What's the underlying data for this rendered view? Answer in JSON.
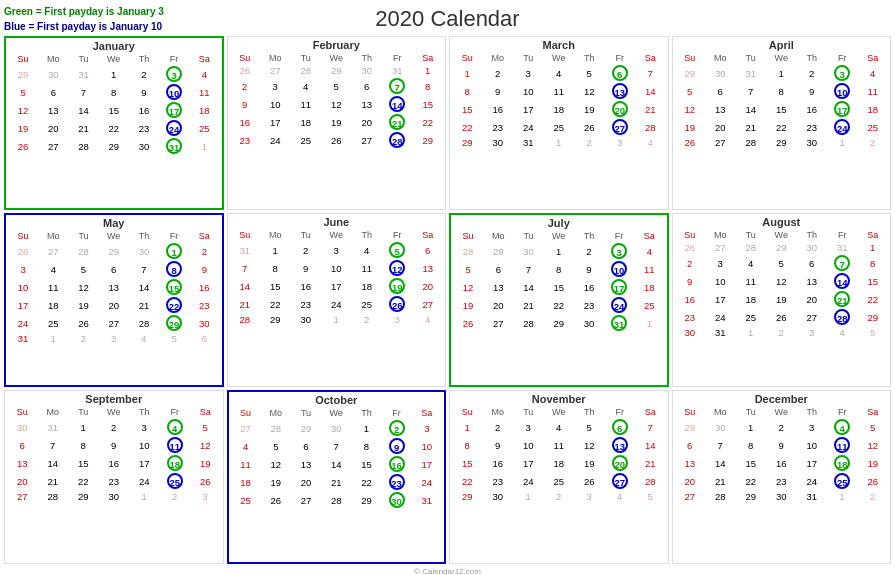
{
  "title": "2020 Calendar",
  "copyright": "© Calendar12.com",
  "legend": {
    "green": "Green = First payday is January 3",
    "blue": "Blue = First payday is January 10"
  },
  "months": [
    {
      "name": "January",
      "border": "green",
      "weeks": [
        [
          "29",
          "30",
          "31",
          "1",
          "2",
          "3",
          "4"
        ],
        [
          "5",
          "6",
          "7",
          "8",
          "9",
          "10",
          "11"
        ],
        [
          "12",
          "13",
          "14",
          "15",
          "16",
          "17",
          "18"
        ],
        [
          "19",
          "20",
          "21",
          "22",
          "23",
          "24",
          "25"
        ],
        [
          "26",
          "27",
          "28",
          "29",
          "30",
          "31",
          "1"
        ]
      ],
      "otherDays": [
        "29",
        "30",
        "31",
        "1"
      ],
      "greenCircles": [
        "3",
        "17",
        "31"
      ],
      "blueCircles": [
        "10",
        "24"
      ],
      "redCells": []
    },
    {
      "name": "February",
      "border": "none",
      "weeks": [
        [
          "26",
          "27",
          "28",
          "29",
          "30",
          "31",
          "1"
        ],
        [
          "2",
          "3",
          "4",
          "5",
          "6",
          "7",
          "8"
        ],
        [
          "9",
          "10",
          "11",
          "12",
          "13",
          "14",
          "15"
        ],
        [
          "16",
          "17",
          "18",
          "19",
          "20",
          "21",
          "22"
        ],
        [
          "23",
          "24",
          "25",
          "26",
          "27",
          "28",
          "29"
        ]
      ],
      "otherDays": [
        "26",
        "27",
        "28",
        "29",
        "30",
        "31"
      ],
      "greenCircles": [
        "7",
        "21"
      ],
      "blueCircles": [
        "14",
        "28"
      ],
      "redCells": []
    },
    {
      "name": "March",
      "border": "none",
      "weeks": [
        [
          "1",
          "2",
          "3",
          "4",
          "5",
          "6",
          "7"
        ],
        [
          "8",
          "9",
          "10",
          "11",
          "12",
          "13",
          "14"
        ],
        [
          "15",
          "16",
          "17",
          "18",
          "19",
          "20",
          "21"
        ],
        [
          "22",
          "23",
          "24",
          "25",
          "26",
          "27",
          "28"
        ],
        [
          "29",
          "30",
          "31",
          "1",
          "2",
          "3",
          "4"
        ]
      ],
      "otherDays": [
        "1",
        "2",
        "3",
        "4"
      ],
      "greenCircles": [
        "6",
        "20"
      ],
      "blueCircles": [
        "13",
        "27"
      ],
      "redCells": []
    },
    {
      "name": "April",
      "border": "none",
      "weeks": [
        [
          "29",
          "30",
          "31",
          "1",
          "2",
          "3",
          "4"
        ],
        [
          "5",
          "6",
          "7",
          "8",
          "9",
          "10",
          "11"
        ],
        [
          "12",
          "13",
          "14",
          "15",
          "16",
          "17",
          "18"
        ],
        [
          "19",
          "20",
          "21",
          "22",
          "23",
          "24",
          "25"
        ],
        [
          "26",
          "27",
          "28",
          "29",
          "30",
          "1",
          "2"
        ]
      ],
      "otherDays": [
        "29",
        "30",
        "31",
        "1",
        "2"
      ],
      "greenCircles": [
        "3",
        "17"
      ],
      "blueCircles": [
        "10",
        "24"
      ],
      "redCells": []
    },
    {
      "name": "May",
      "border": "blue",
      "weeks": [
        [
          "26",
          "27",
          "28",
          "29",
          "30",
          "1",
          "2"
        ],
        [
          "3",
          "4",
          "5",
          "6",
          "7",
          "8",
          "9"
        ],
        [
          "10",
          "11",
          "12",
          "13",
          "14",
          "15",
          "16"
        ],
        [
          "17",
          "18",
          "19",
          "20",
          "21",
          "22",
          "23"
        ],
        [
          "24",
          "25",
          "26",
          "27",
          "28",
          "29",
          "30"
        ],
        [
          "31",
          "1",
          "2",
          "3",
          "4",
          "5",
          "6"
        ]
      ],
      "otherDays": [
        "26",
        "27",
        "28",
        "29",
        "30",
        "1",
        "2",
        "3",
        "4",
        "5",
        "6"
      ],
      "greenCircles": [
        "1",
        "15",
        "29"
      ],
      "blueCircles": [
        "8",
        "22"
      ],
      "redCells": []
    },
    {
      "name": "June",
      "border": "none",
      "weeks": [
        [
          "31",
          "1",
          "2",
          "3",
          "4",
          "5",
          "6"
        ],
        [
          "7",
          "8",
          "9",
          "10",
          "11",
          "12",
          "13"
        ],
        [
          "14",
          "15",
          "16",
          "17",
          "18",
          "19",
          "20"
        ],
        [
          "21",
          "22",
          "23",
          "24",
          "25",
          "26",
          "27"
        ],
        [
          "28",
          "29",
          "30",
          "1",
          "2",
          "3",
          "4"
        ]
      ],
      "otherDays": [
        "31",
        "1",
        "2",
        "3",
        "4"
      ],
      "greenCircles": [
        "5",
        "19"
      ],
      "blueCircles": [
        "12",
        "26"
      ],
      "redCells": []
    },
    {
      "name": "July",
      "border": "green",
      "weeks": [
        [
          "28",
          "29",
          "30",
          "1",
          "2",
          "3",
          "4"
        ],
        [
          "5",
          "6",
          "7",
          "8",
          "9",
          "10",
          "11"
        ],
        [
          "12",
          "13",
          "14",
          "15",
          "16",
          "17",
          "18"
        ],
        [
          "19",
          "20",
          "21",
          "22",
          "23",
          "24",
          "25"
        ],
        [
          "26",
          "27",
          "28",
          "29",
          "30",
          "31",
          "1"
        ]
      ],
      "otherDays": [
        "28",
        "29",
        "30",
        "1"
      ],
      "greenCircles": [
        "3",
        "17",
        "31"
      ],
      "blueCircles": [
        "10",
        "24"
      ],
      "redCells": []
    },
    {
      "name": "August",
      "border": "none",
      "weeks": [
        [
          "26",
          "27",
          "28",
          "29",
          "30",
          "31",
          "1"
        ],
        [
          "2",
          "3",
          "4",
          "5",
          "6",
          "7",
          "8"
        ],
        [
          "9",
          "10",
          "11",
          "12",
          "13",
          "14",
          "15"
        ],
        [
          "16",
          "17",
          "18",
          "19",
          "20",
          "21",
          "22"
        ],
        [
          "23",
          "24",
          "25",
          "26",
          "27",
          "28",
          "29"
        ],
        [
          "30",
          "31",
          "1",
          "2",
          "3",
          "4",
          "5"
        ]
      ],
      "otherDays": [
        "26",
        "27",
        "28",
        "29",
        "30",
        "31",
        "1",
        "2",
        "3",
        "4",
        "5"
      ],
      "greenCircles": [
        "7",
        "21"
      ],
      "blueCircles": [
        "14",
        "28"
      ],
      "redCells": []
    },
    {
      "name": "September",
      "border": "none",
      "weeks": [
        [
          "30",
          "31",
          "1",
          "2",
          "3",
          "4",
          "5"
        ],
        [
          "6",
          "7",
          "8",
          "9",
          "10",
          "11",
          "12"
        ],
        [
          "13",
          "14",
          "15",
          "16",
          "17",
          "18",
          "19"
        ],
        [
          "20",
          "21",
          "22",
          "23",
          "24",
          "25",
          "26"
        ],
        [
          "27",
          "28",
          "29",
          "30",
          "1",
          "2",
          "3"
        ]
      ],
      "otherDays": [
        "30",
        "31",
        "1",
        "2",
        "3"
      ],
      "greenCircles": [
        "4",
        "18"
      ],
      "blueCircles": [
        "11",
        "25"
      ],
      "redCells": []
    },
    {
      "name": "October",
      "border": "blue",
      "weeks": [
        [
          "27",
          "28",
          "29",
          "30",
          "1",
          "2",
          "3"
        ],
        [
          "4",
          "5",
          "6",
          "7",
          "8",
          "9",
          "10"
        ],
        [
          "11",
          "12",
          "13",
          "14",
          "15",
          "16",
          "17"
        ],
        [
          "18",
          "19",
          "20",
          "21",
          "22",
          "23",
          "24"
        ],
        [
          "25",
          "26",
          "27",
          "28",
          "29",
          "30",
          "31"
        ]
      ],
      "otherDays": [
        "27",
        "28",
        "29",
        "30"
      ],
      "greenCircles": [
        "2",
        "16",
        "30"
      ],
      "blueCircles": [
        "9",
        "23"
      ],
      "redCells": []
    },
    {
      "name": "November",
      "border": "none",
      "weeks": [
        [
          "1",
          "2",
          "3",
          "4",
          "5",
          "6",
          "7"
        ],
        [
          "8",
          "9",
          "10",
          "11",
          "12",
          "13",
          "14"
        ],
        [
          "15",
          "16",
          "17",
          "18",
          "19",
          "20",
          "21"
        ],
        [
          "22",
          "23",
          "24",
          "25",
          "26",
          "27",
          "28"
        ],
        [
          "29",
          "30",
          "1",
          "2",
          "3",
          "4",
          "5"
        ]
      ],
      "otherDays": [
        "1",
        "2",
        "3",
        "4",
        "5"
      ],
      "greenCircles": [
        "6",
        "20"
      ],
      "blueCircles": [
        "13",
        "27"
      ],
      "redCells": []
    },
    {
      "name": "December",
      "border": "none",
      "weeks": [
        [
          "29",
          "30",
          "1",
          "2",
          "3",
          "4",
          "5"
        ],
        [
          "6",
          "7",
          "8",
          "9",
          "10",
          "11",
          "12"
        ],
        [
          "13",
          "14",
          "15",
          "16",
          "17",
          "18",
          "19"
        ],
        [
          "20",
          "21",
          "22",
          "23",
          "24",
          "25",
          "26"
        ],
        [
          "27",
          "28",
          "29",
          "30",
          "31",
          "1",
          "2"
        ]
      ],
      "otherDays": [
        "29",
        "30",
        "1",
        "2"
      ],
      "greenCircles": [
        "4",
        "18"
      ],
      "blueCircles": [
        "11",
        "25"
      ],
      "redCells": []
    }
  ]
}
